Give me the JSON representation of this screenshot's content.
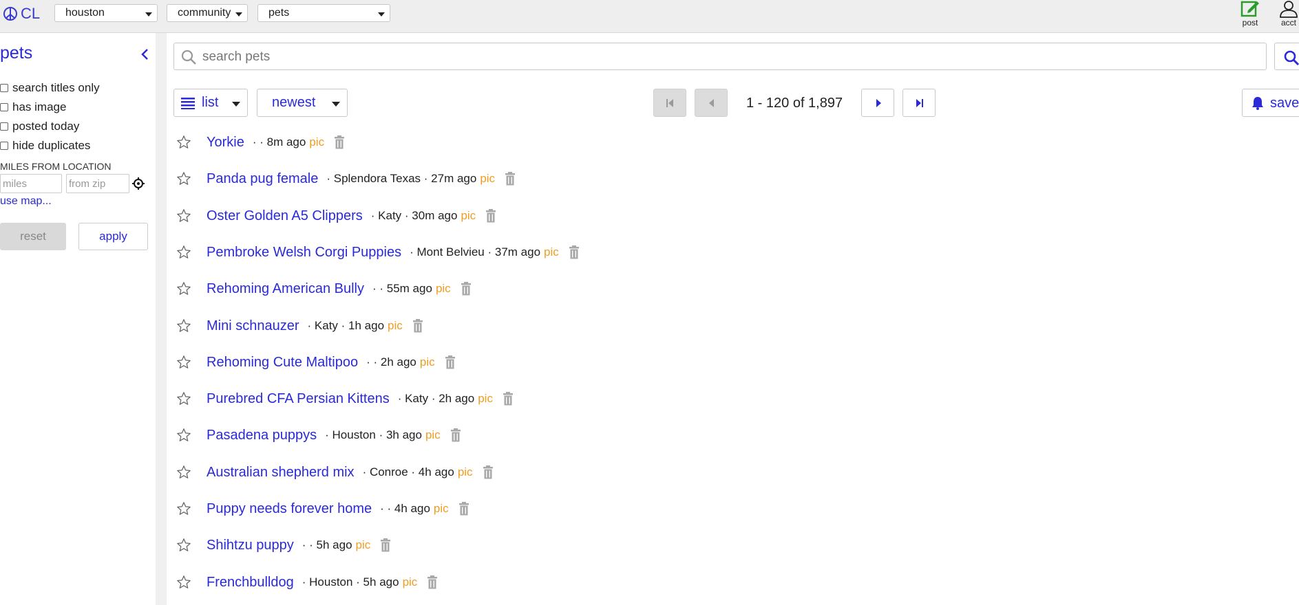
{
  "header": {
    "logo_text": "CL",
    "logo_icon": "peace-sign-icon",
    "selects": [
      {
        "value": "houston"
      },
      {
        "value": "community"
      },
      {
        "value": "pets"
      }
    ],
    "post_label": "post",
    "acct_label": "acct"
  },
  "sidebar": {
    "title": "pets",
    "filters": [
      "search titles only",
      "has image",
      "posted today",
      "hide duplicates"
    ],
    "miles_label": "MILES FROM LOCATION",
    "miles_placeholder": "miles",
    "zip_placeholder": "from zip",
    "use_map": "use map...",
    "reset": "reset",
    "apply": "apply"
  },
  "search": {
    "placeholder": "search pets"
  },
  "toolbar": {
    "view": "list",
    "sort": "newest",
    "pagination": "1 - 120 of 1,897",
    "save": "save"
  },
  "colors": {
    "link": "#2a2ad8",
    "pic": "#f29c1f",
    "post_icon": "#2a9c2a"
  },
  "results": [
    {
      "title": "Yorkie",
      "meta": "·  · 8m ago",
      "pic": "pic"
    },
    {
      "title": "Panda pug female",
      "meta": "· Splendora Texas · 27m ago",
      "pic": "pic"
    },
    {
      "title": "Oster Golden A5 Clippers",
      "meta": "· Katy · 30m ago",
      "pic": "pic"
    },
    {
      "title": "Pembroke Welsh Corgi Puppies",
      "meta": "· Mont Belvieu · 37m ago",
      "pic": "pic"
    },
    {
      "title": "Rehoming American Bully",
      "meta": "·  · 55m ago",
      "pic": "pic"
    },
    {
      "title": "Mini schnauzer",
      "meta": "· Katy · 1h ago",
      "pic": "pic"
    },
    {
      "title": "Rehoming Cute Maltipoo",
      "meta": "·  · 2h ago",
      "pic": "pic"
    },
    {
      "title": "Purebred CFA Persian Kittens",
      "meta": "· Katy · 2h ago",
      "pic": "pic"
    },
    {
      "title": "Pasadena puppys",
      "meta": "· Houston · 3h ago",
      "pic": "pic"
    },
    {
      "title": "Australian shepherd mix",
      "meta": "· Conroe · 4h ago",
      "pic": "pic"
    },
    {
      "title": "Puppy needs forever home",
      "meta": "·  · 4h ago",
      "pic": "pic"
    },
    {
      "title": "Shihtzu puppy",
      "meta": "·  · 5h ago",
      "pic": "pic"
    },
    {
      "title": "Frenchbulldog",
      "meta": "· Houston · 5h ago",
      "pic": "pic"
    }
  ]
}
